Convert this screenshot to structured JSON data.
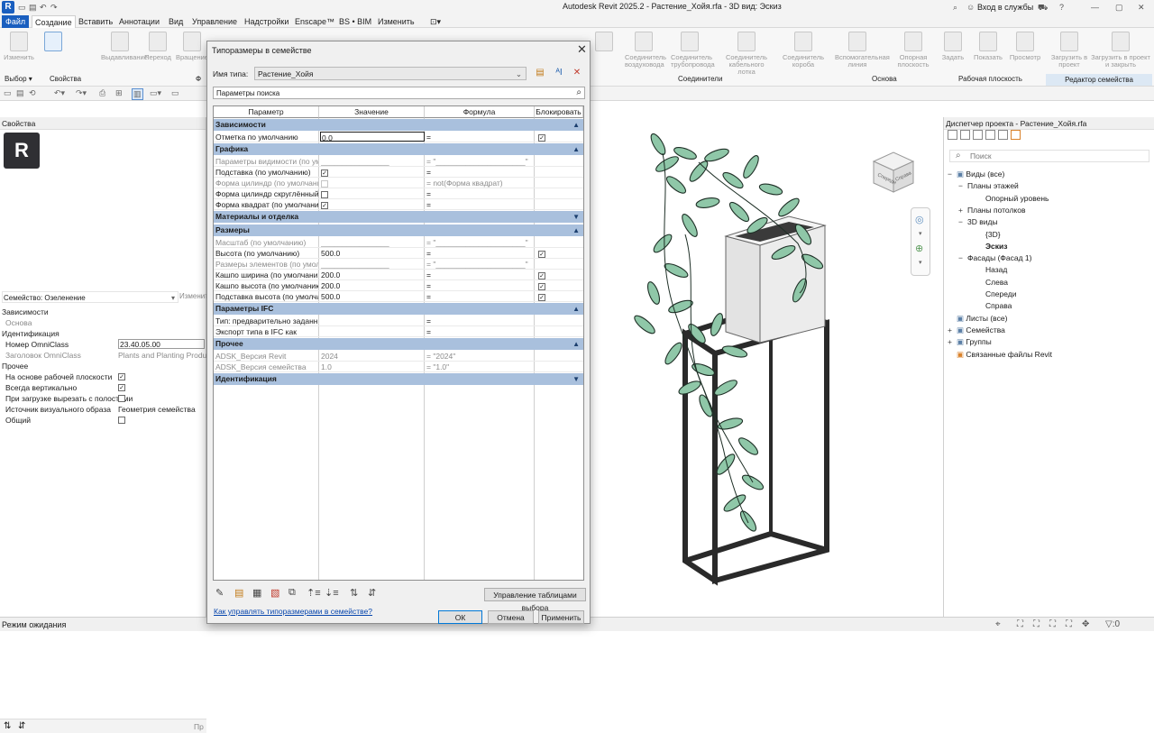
{
  "window": {
    "title": "Autodesk Revit 2025.2 - Растение_Хойя.rfa - 3D вид: Эскиз",
    "app_icon": "R",
    "sign_in": "Вход в службы",
    "help": "?"
  },
  "menu": [
    "Файл",
    "Создание",
    "Вставить",
    "Аннотации",
    "Вид",
    "Управление",
    "Надстройки",
    "Enscape™",
    "BS • BIM",
    "Изменить"
  ],
  "ribbon": {
    "buttons": [
      "Изменить",
      "Выдавливание",
      "Переход",
      "Вращение",
      "Соединитель",
      "Соединитель воздуховода",
      "Соединитель трубопровода",
      "Соединитель кабельного лотка",
      "Соединитель короба",
      "Вспомогательная линия",
      "Опорная плоскость",
      "Задать",
      "Показать",
      "Просмотр",
      "Загрузить в проект",
      "Загрузить в проект и закрыть"
    ],
    "groups": [
      "Выбор ▾",
      "Свойства",
      "Ф",
      "Соединители",
      "Основа",
      "Рабочая плоскость",
      "Редактор семейства"
    ]
  },
  "properties": {
    "title": "Свойства",
    "family_type": "Семейство: Озеленение",
    "edit_type": "Изменить",
    "rows": [
      {
        "k": "Зависимости",
        "kind": "head"
      },
      {
        "k": "Основа",
        "kind": "grey",
        "v": ""
      },
      {
        "k": "Идентификация",
        "kind": "head"
      },
      {
        "k": "Номер OmniClass",
        "v": "23.40.05.00"
      },
      {
        "k": "Заголовок OmniClass",
        "kind": "grey",
        "v": "Plants and Planting Products"
      },
      {
        "k": "Прочее",
        "kind": "head"
      },
      {
        "k": "На основе рабочей плоскости",
        "chk": true
      },
      {
        "k": "Всегда вертикально",
        "chk": true
      },
      {
        "k": "При загрузке вырезать с полостями",
        "chk": false
      },
      {
        "k": "Источник визуального образа",
        "v": "Геометрия семейства"
      },
      {
        "k": "Общий",
        "chk": false
      }
    ],
    "apply": "Пр"
  },
  "status": {
    "text": "Режим ожидания"
  },
  "dialog": {
    "title": "Типоразмеры в семействе",
    "type_label": "Имя типа:",
    "type_name": "Растение_Хойя",
    "search_placeholder": "Параметры поиска",
    "columns": [
      "Параметр",
      "Значение",
      "Формула",
      "Блокировать"
    ],
    "groups": [
      {
        "name": "Зависимости",
        "arrow": "▲",
        "rows": [
          {
            "p": "Отметка по умолчанию",
            "v": "0.0",
            "f": "=",
            "lock": true,
            "sel": true
          }
        ]
      },
      {
        "name": "Графика",
        "arrow": "▲",
        "rows": [
          {
            "p": "Параметры видимости (по ум",
            "v": "________________",
            "f": "= \"_____________________\"",
            "grey": true
          },
          {
            "p": "Подставка (по умолчанию)",
            "chk": true,
            "f": "="
          },
          {
            "p": "Форма цилиндр (по умолчани",
            "f": "= not(Форма квадрат)",
            "grey": true,
            "chk": false
          },
          {
            "p": "Форма цилиндр скруглённый",
            "chk": false,
            "f": "="
          },
          {
            "p": "Форма квадрат (по умолчани",
            "chk": true,
            "f": "="
          }
        ]
      },
      {
        "name": "Материалы и отделка",
        "arrow": "▼",
        "rows": []
      },
      {
        "name": "Размеры",
        "arrow": "▲",
        "rows": [
          {
            "p": "Масштаб (по умолчанию)",
            "v": "________________",
            "f": "= \"_____________________\"",
            "grey": true
          },
          {
            "p": "Высота (по умолчанию)",
            "v": "500.0",
            "f": "=",
            "lock": true
          },
          {
            "p": "Размеры элементов (по умолч",
            "v": "________________",
            "f": "= \"_____________________\"",
            "grey": true
          },
          {
            "p": "Кашпо ширина (по умолчани",
            "v": "200.0",
            "f": "=",
            "lock": true
          },
          {
            "p": "Кашпо высота (по умолчанию",
            "v": "200.0",
            "f": "=",
            "lock": true
          },
          {
            "p": "Подставка высота (по умолча",
            "v": "500.0",
            "f": "=",
            "lock": true
          }
        ]
      },
      {
        "name": "Параметры IFC",
        "arrow": "▲",
        "rows": [
          {
            "p": "Тип: предварительно заданны",
            "f": "="
          },
          {
            "p": "Экспорт типа в IFC как",
            "f": "="
          }
        ]
      },
      {
        "name": "Прочее",
        "arrow": "▲",
        "rows": [
          {
            "p": "ADSK_Версия Revit",
            "v": "2024",
            "f": "= \"2024\"",
            "grey": true
          },
          {
            "p": "ADSK_Версия семейства",
            "v": "1.0",
            "f": "= \"1.0\"",
            "grey": true
          }
        ]
      },
      {
        "name": "Идентификация",
        "arrow": "▼",
        "rows": []
      }
    ],
    "manage_btn": "Управление таблицами выбора",
    "help_link": "Как управлять типоразмерами в семействе?",
    "ok": "ОК",
    "cancel": "Отмена",
    "apply": "Применить"
  },
  "viewcube": {
    "face_left": "Спереди",
    "face_right": "Справа"
  },
  "project_browser": {
    "title": "Диспетчер проекта - Растение_Хойя.rfa",
    "search": "Поиск",
    "tree": [
      {
        "t": "Виды (все)",
        "d": 0,
        "ex": "−"
      },
      {
        "t": "Планы этажей",
        "d": 1,
        "ex": "−"
      },
      {
        "t": "Опорный уровень",
        "d": 2
      },
      {
        "t": "Планы потолков",
        "d": 1,
        "ex": "+"
      },
      {
        "t": "3D виды",
        "d": 1,
        "ex": "−"
      },
      {
        "t": "{3D}",
        "d": 2
      },
      {
        "t": "Эскиз",
        "d": 2,
        "bold": true
      },
      {
        "t": "Фасады (Фасад 1)",
        "d": 1,
        "ex": "−"
      },
      {
        "t": "Назад",
        "d": 2
      },
      {
        "t": "Слева",
        "d": 2
      },
      {
        "t": "Спереди",
        "d": 2
      },
      {
        "t": "Справа",
        "d": 2
      },
      {
        "t": "Листы (все)",
        "d": 0
      },
      {
        "t": "Семейства",
        "d": 0,
        "ex": "+"
      },
      {
        "t": "Группы",
        "d": 0,
        "ex": "+"
      },
      {
        "t": "Связанные файлы Revit",
        "d": 0
      }
    ]
  },
  "colors": {
    "accent": "#1a5fbf",
    "group_header": "#a9c0dd",
    "leaf": "#8fc7a8"
  }
}
